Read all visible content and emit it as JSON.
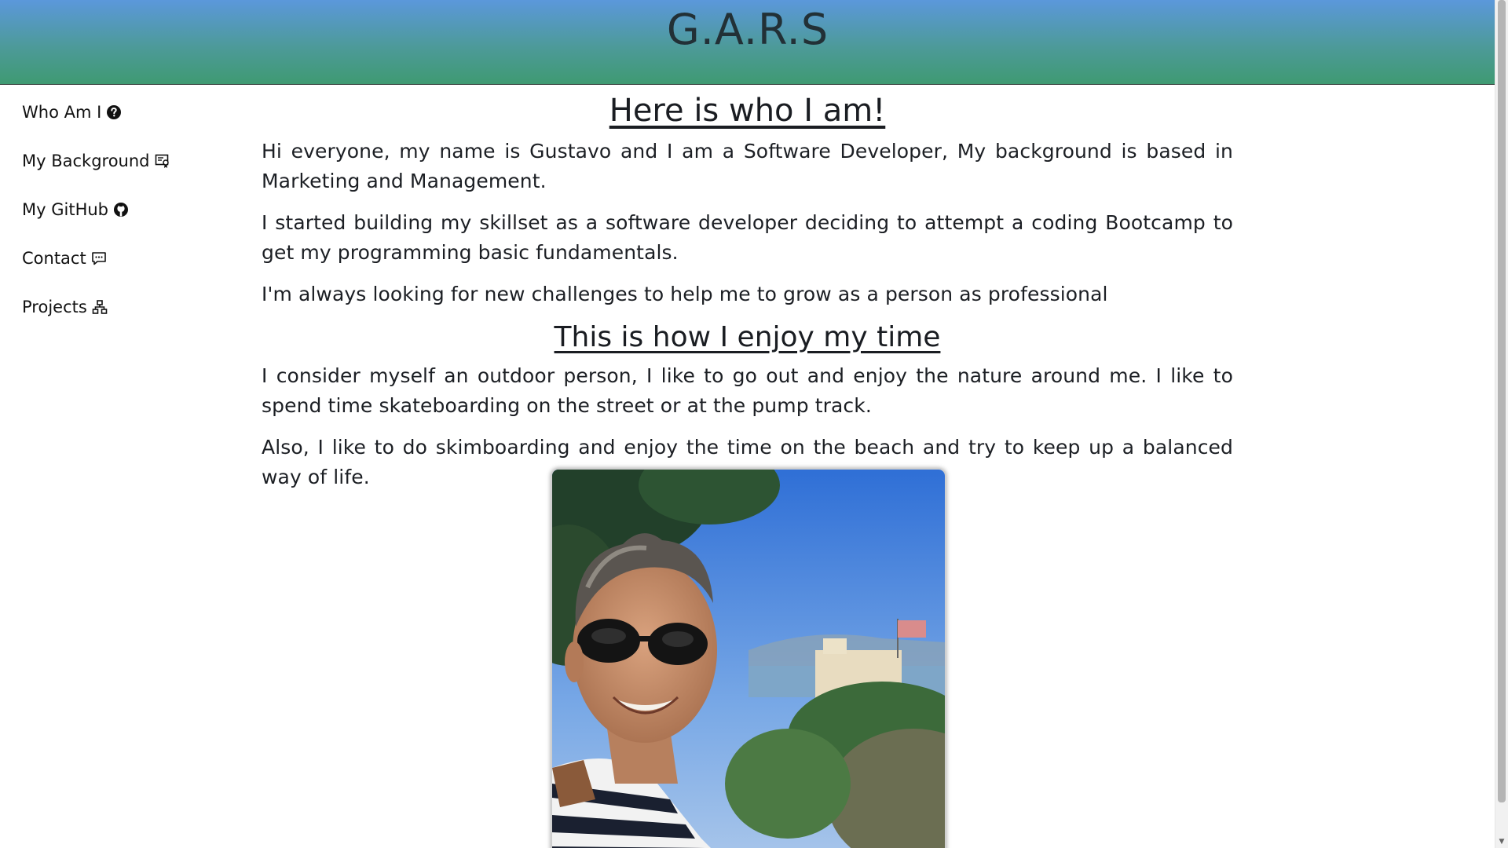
{
  "header": {
    "title": "G.A.R.S"
  },
  "sidebar": {
    "items": [
      {
        "label": "Who Am I",
        "icon": "question-circle-icon"
      },
      {
        "label": "My Background",
        "icon": "certificate-icon"
      },
      {
        "label": "My GitHub",
        "icon": "github-icon"
      },
      {
        "label": "Contact",
        "icon": "chat-icon"
      },
      {
        "label": "Projects",
        "icon": "diagram-icon"
      }
    ]
  },
  "main": {
    "heading1": "Here is who I am!",
    "paragraphs1": [
      "Hi everyone, my name is Gustavo and I am a Software Developer, My background is based in Marketing and Management.",
      "I started building my skillset as a software developer deciding to attempt a coding Bootcamp to get my programming basic fundamentals.",
      "I'm always looking for new challenges to help me to grow as a person as professional"
    ],
    "heading2": "This is how I enjoy my time",
    "paragraphs2": [
      "I consider myself an outdoor person, I like to go out and enjoy the nature around me. I like to spend time skateboarding on the street or at the pump track.",
      "Also, I like to do skimboarding and enjoy the time on the beach and try to keep up a balanced way of life."
    ]
  },
  "colors": {
    "header_top": "#5b98db",
    "header_bottom": "#3f9a72"
  }
}
